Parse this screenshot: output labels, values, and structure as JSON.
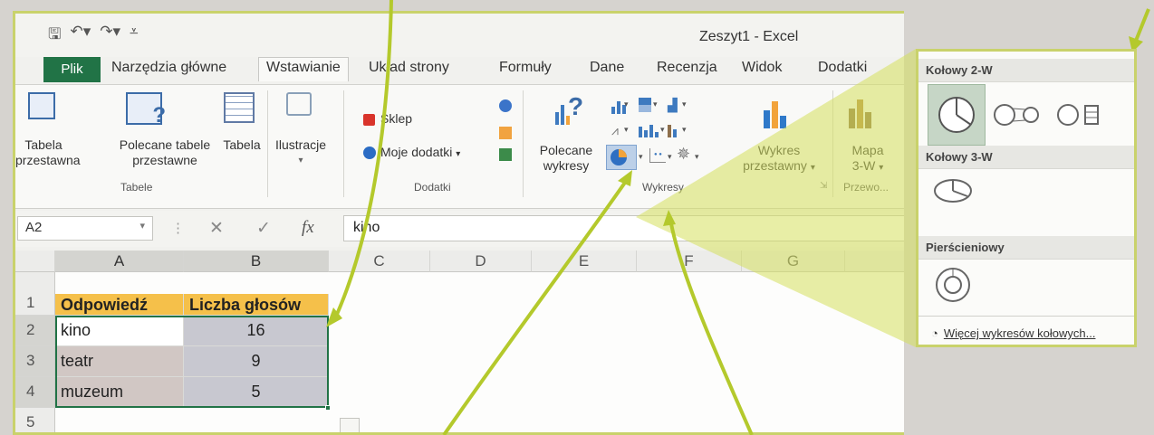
{
  "window": {
    "title": "Zeszyt1 - Excel"
  },
  "tabs": [
    "Plik",
    "Narzędzia główne",
    "Wstawianie",
    "Układ strony",
    "Formuły",
    "Dane",
    "Recenzja",
    "Widok",
    "Dodatki"
  ],
  "ribbon": {
    "tables": {
      "pivot": [
        "Tabela",
        "przestawna"
      ],
      "recommended": [
        "Polecane tabele",
        "przestawne"
      ],
      "table": "Tabela",
      "group": "Tabele"
    },
    "illustrations": "Ilustracje",
    "addins": {
      "store": "Sklep",
      "my": "Moje dodatki",
      "group": "Dodatki"
    },
    "charts": {
      "recommended": [
        "Polecane",
        "wykresy"
      ],
      "pivot_chart": [
        "Wykres",
        "przestawny"
      ],
      "group": "Wykresy"
    },
    "tours": {
      "map": [
        "Mapa",
        "3-W"
      ],
      "group": "Przewo..."
    }
  },
  "formula_bar": {
    "name_box": "A2",
    "fx": "fx",
    "value": "kino"
  },
  "sheet": {
    "columns": [
      "A",
      "B",
      "C",
      "D",
      "E",
      "F",
      "G"
    ],
    "rows": [
      "1",
      "2",
      "3",
      "4",
      "5"
    ],
    "headers": [
      "Odpowiedź",
      "Liczba głosów"
    ],
    "data": [
      [
        "kino",
        "16"
      ],
      [
        "teatr",
        "9"
      ],
      [
        "muzeum",
        "5"
      ]
    ]
  },
  "pie_menu": {
    "sections": [
      "Kołowy 2-W",
      "Kołowy 3-W",
      "Pierścieniowy"
    ],
    "more": "Więcej wykresów kołowych..."
  },
  "colors": {
    "excel_green": "#217346",
    "header_fill": "#f5c04a",
    "highlight": "#c9d26b"
  }
}
